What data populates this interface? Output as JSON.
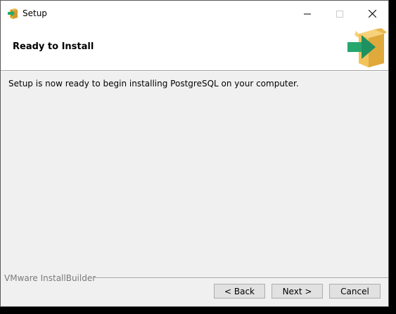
{
  "window": {
    "title": "Setup"
  },
  "header": {
    "title": "Ready to Install"
  },
  "main": {
    "message": "Setup is now ready to begin installing PostgreSQL on your computer."
  },
  "footer": {
    "brand": "VMware InstallBuilder",
    "back_label": "< Back",
    "next_label": "Next >",
    "cancel_label": "Cancel"
  },
  "icons": {
    "app": "installer-arrow-box-icon",
    "minimize": "minimize-icon",
    "maximize": "maximize-icon",
    "close": "close-icon",
    "logo": "installer-arrow-box-icon"
  },
  "colors": {
    "window_bg": "#f0f0f0",
    "header_bg": "#ffffff",
    "box": "#f2c04f",
    "arrow": "#27a66e"
  }
}
